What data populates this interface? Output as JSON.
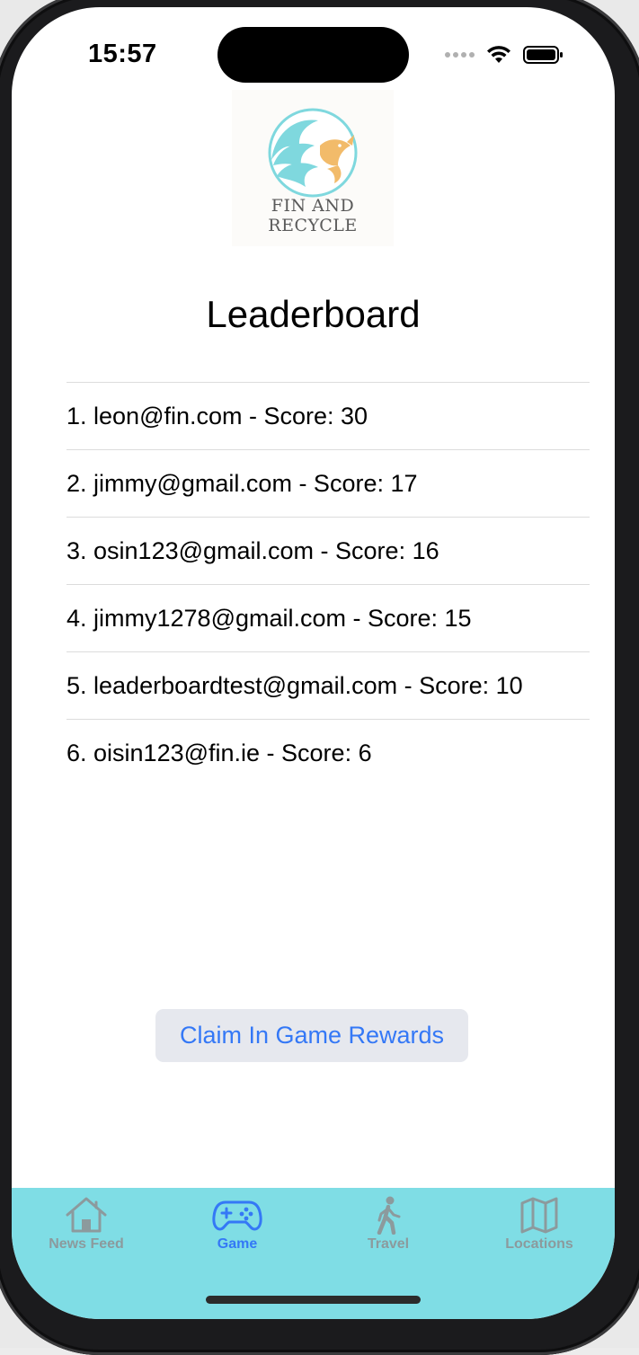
{
  "status_bar": {
    "time": "15:57"
  },
  "logo": {
    "line1": "FIN AND",
    "line2": "RECYCLE",
    "icon": "wave-fish-logo"
  },
  "page": {
    "title": "Leaderboard"
  },
  "leaderboard": {
    "entries": [
      "1. leon@fin.com - Score: 30",
      "2. jimmy@gmail.com - Score: 17",
      "3. osin123@gmail.com - Score: 16",
      "4. jimmy1278@gmail.com - Score: 15",
      "5. leaderboardtest@gmail.com - Score: 10",
      "6. oisin123@fin.ie - Score: 6"
    ]
  },
  "actions": {
    "claim_label": "Claim In Game Rewards"
  },
  "tab_bar": {
    "items": [
      {
        "label": "News Feed",
        "icon": "house-icon",
        "active": false
      },
      {
        "label": "Game",
        "icon": "gamecontroller-icon",
        "active": true
      },
      {
        "label": "Travel",
        "icon": "walking-figure-icon",
        "active": false
      },
      {
        "label": "Locations",
        "icon": "map-icon",
        "active": false
      }
    ]
  },
  "colors": {
    "accent": "#3478f6",
    "tab_bar_background": "#7fdde5",
    "tab_inactive": "#8c9a9d",
    "button_background": "#e6e8ee",
    "logo_wave": "#7fd8de",
    "logo_fish": "#f2bb6a"
  }
}
